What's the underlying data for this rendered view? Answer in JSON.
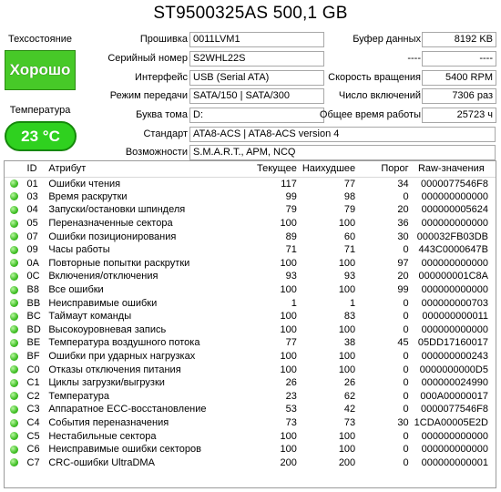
{
  "window": {
    "title": "ST9500325AS 500,1 GB"
  },
  "health": {
    "label": "Техсостояние",
    "status": "Хорошо"
  },
  "temperature": {
    "label": "Температура",
    "value": "23 °C"
  },
  "info": {
    "firmware": {
      "label": "Прошивка",
      "value": "0011LVM1"
    },
    "serial": {
      "label": "Серийный номер",
      "value": "S2WHL22S"
    },
    "interface": {
      "label": "Интерфейс",
      "value": "USB (Serial ATA)"
    },
    "transfer_mode": {
      "label": "Режим передачи",
      "value": "SATA/150 | SATA/300"
    },
    "drive_letter": {
      "label": "Буква тома",
      "value": "D:"
    },
    "standard": {
      "label": "Стандарт",
      "value": "ATA8-ACS | ATA8-ACS version 4"
    },
    "features": {
      "label": "Возможности",
      "value": "S.M.A.R.T., APM, NCQ"
    },
    "buffer": {
      "label": "Буфер данных",
      "value": "8192 KB"
    },
    "blank1": {
      "label": "----",
      "value": "----"
    },
    "rotation": {
      "label": "Скорость вращения",
      "value": "5400 RPM"
    },
    "power_count": {
      "label": "Число включений",
      "value": "7306 раз"
    },
    "power_hours": {
      "label": "Общее время работы",
      "value": "25723 ч"
    }
  },
  "smart": {
    "headers": {
      "id": "ID",
      "attr": "Атрибут",
      "current": "Текущее",
      "worst": "Наихудшее",
      "threshold": "Порог",
      "raw": "Raw-значения"
    },
    "rows": [
      {
        "id": "01",
        "attr": "Ошибки чтения",
        "current": "117",
        "worst": "77",
        "threshold": "34",
        "raw": "0000077546F8"
      },
      {
        "id": "03",
        "attr": "Время раскрутки",
        "current": "99",
        "worst": "98",
        "threshold": "0",
        "raw": "000000000000"
      },
      {
        "id": "04",
        "attr": "Запуски/остановки шпинделя",
        "current": "79",
        "worst": "79",
        "threshold": "20",
        "raw": "000000005624"
      },
      {
        "id": "05",
        "attr": "Переназначенные сектора",
        "current": "100",
        "worst": "100",
        "threshold": "36",
        "raw": "000000000000"
      },
      {
        "id": "07",
        "attr": "Ошибки позиционирования",
        "current": "89",
        "worst": "60",
        "threshold": "30",
        "raw": "000032FB03DB"
      },
      {
        "id": "09",
        "attr": "Часы работы",
        "current": "71",
        "worst": "71",
        "threshold": "0",
        "raw": "443C0000647B"
      },
      {
        "id": "0A",
        "attr": "Повторные попытки раскрутки",
        "current": "100",
        "worst": "100",
        "threshold": "97",
        "raw": "000000000000"
      },
      {
        "id": "0C",
        "attr": "Включения/отключения",
        "current": "93",
        "worst": "93",
        "threshold": "20",
        "raw": "000000001C8A"
      },
      {
        "id": "B8",
        "attr": "Все ошибки",
        "current": "100",
        "worst": "100",
        "threshold": "99",
        "raw": "000000000000"
      },
      {
        "id": "BB",
        "attr": "Неисправимые ошибки",
        "current": "1",
        "worst": "1",
        "threshold": "0",
        "raw": "000000000703"
      },
      {
        "id": "BC",
        "attr": "Таймаут команды",
        "current": "100",
        "worst": "83",
        "threshold": "0",
        "raw": "000000000011"
      },
      {
        "id": "BD",
        "attr": "Высокоуровневая запись",
        "current": "100",
        "worst": "100",
        "threshold": "0",
        "raw": "000000000000"
      },
      {
        "id": "BE",
        "attr": "Температура воздушного потока",
        "current": "77",
        "worst": "38",
        "threshold": "45",
        "raw": "05DD17160017"
      },
      {
        "id": "BF",
        "attr": "Ошибки при ударных нагрузках",
        "current": "100",
        "worst": "100",
        "threshold": "0",
        "raw": "000000000243"
      },
      {
        "id": "C0",
        "attr": "Отказы отключения питания",
        "current": "100",
        "worst": "100",
        "threshold": "0",
        "raw": "0000000000D5"
      },
      {
        "id": "C1",
        "attr": "Циклы загрузки/выгрузки",
        "current": "26",
        "worst": "26",
        "threshold": "0",
        "raw": "000000024990"
      },
      {
        "id": "C2",
        "attr": "Температура",
        "current": "23",
        "worst": "62",
        "threshold": "0",
        "raw": "000A00000017"
      },
      {
        "id": "C3",
        "attr": "Аппаратное ECC-восстановление",
        "current": "53",
        "worst": "42",
        "threshold": "0",
        "raw": "0000077546F8"
      },
      {
        "id": "C4",
        "attr": "События переназначения",
        "current": "73",
        "worst": "73",
        "threshold": "30",
        "raw": "1CDA00005E2D"
      },
      {
        "id": "C5",
        "attr": "Нестабильные сектора",
        "current": "100",
        "worst": "100",
        "threshold": "0",
        "raw": "000000000000"
      },
      {
        "id": "C6",
        "attr": "Неисправимые ошибки секторов",
        "current": "100",
        "worst": "100",
        "threshold": "0",
        "raw": "000000000000"
      },
      {
        "id": "C7",
        "attr": "CRC-ошибки UltraDMA",
        "current": "200",
        "worst": "200",
        "threshold": "0",
        "raw": "000000000001"
      }
    ]
  },
  "colors": {
    "good": "#47c928",
    "temp_good": "#2fd11f",
    "border": "#a8a8a8"
  }
}
